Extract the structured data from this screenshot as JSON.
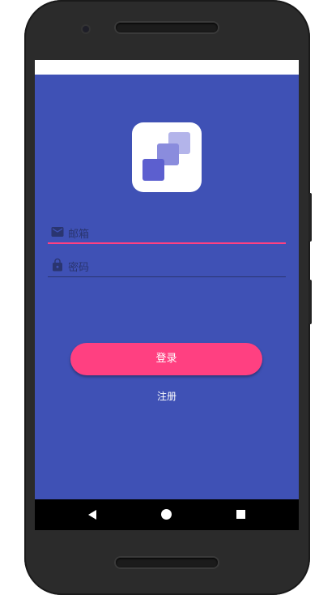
{
  "login": {
    "email_placeholder": "邮箱",
    "password_placeholder": "密码",
    "login_button": "登录",
    "register_link": "注册"
  },
  "icons": {
    "email": "envelope-icon",
    "password": "lock-icon",
    "back": "nav-back-icon",
    "home": "nav-home-icon",
    "recent": "nav-recent-icon"
  },
  "colors": {
    "primary": "#3f51b5",
    "accent": "#ff4081",
    "logo_square_dark": "#5c5fcf",
    "logo_square_mid": "#8a8cdd",
    "logo_square_light": "#b3b4ea"
  }
}
